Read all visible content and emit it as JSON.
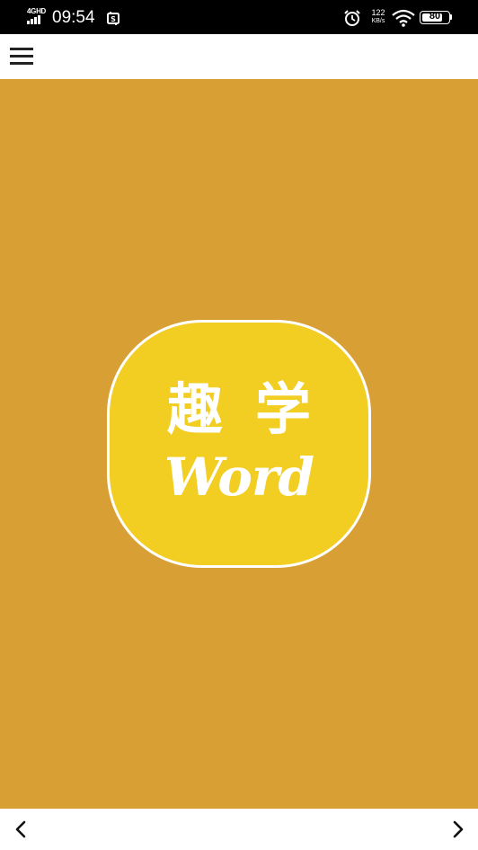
{
  "status_bar": {
    "network": "4GHD",
    "time": "09:54",
    "net_speed_value": "122",
    "net_speed_unit": "KB/s",
    "battery_level": "80",
    "battery_fraction": 0.8
  },
  "app_bar": {
    "menu_icon": "hamburger-menu-icon"
  },
  "splash": {
    "background_color": "#d89f35",
    "logo_color": "#f2cd22",
    "logo_title": "趣学",
    "logo_subtitle": "Word"
  },
  "nav": {
    "back_icon": "chevron-left-icon",
    "forward_icon": "chevron-right-icon"
  }
}
